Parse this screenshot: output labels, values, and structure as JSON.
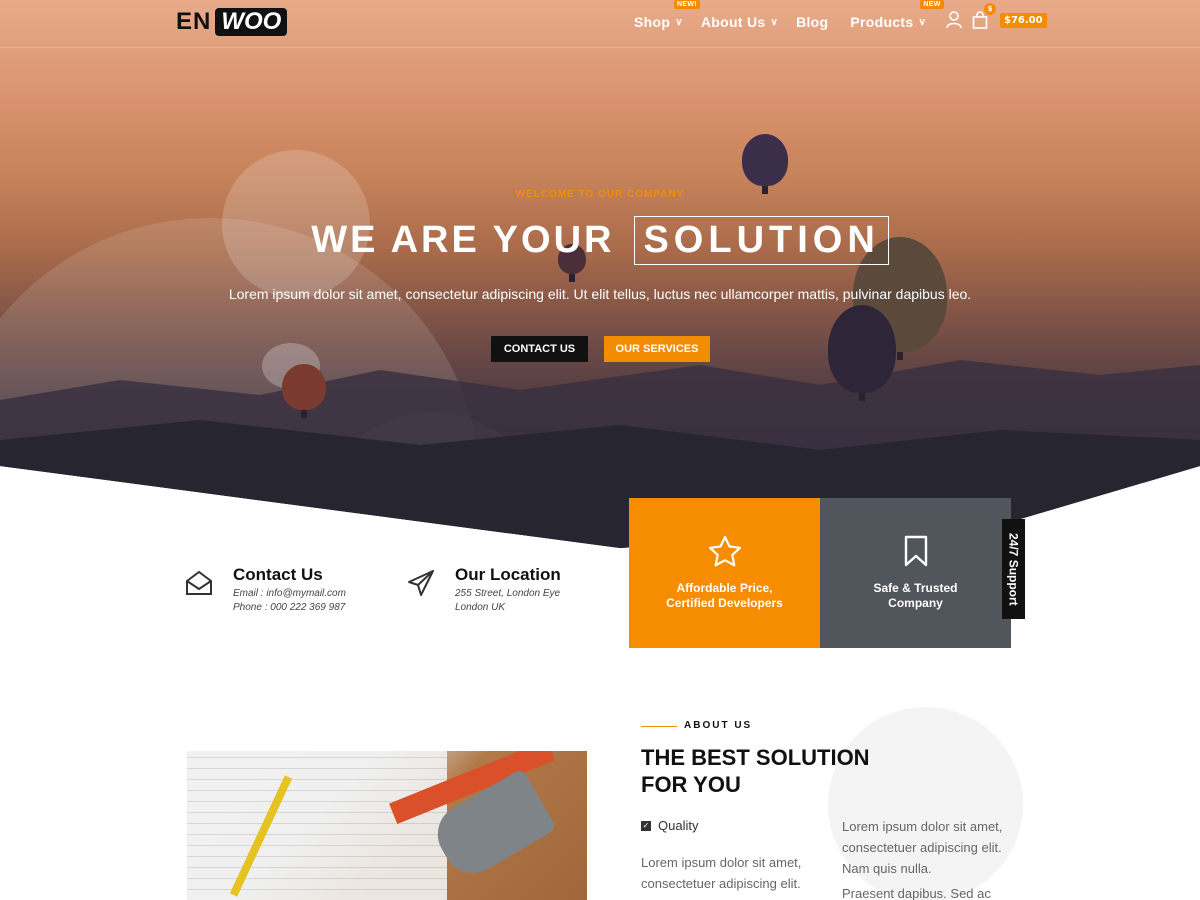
{
  "header": {
    "logo_left": "EN",
    "logo_right": "WOO",
    "nav": [
      {
        "label": "Shop",
        "tag": "NEW!"
      },
      {
        "label": "About Us",
        "tag": ""
      },
      {
        "label": "Blog",
        "tag": ""
      },
      {
        "label": "Products",
        "tag": "NEW"
      }
    ],
    "cart_count": "$",
    "cart_price": "$76.00"
  },
  "hero": {
    "eyebrow": "WELCOME TO OUR COMPANY",
    "headline_plain": "WE ARE YOUR",
    "headline_boxed": "SOLUTION",
    "subtitle": "Lorem ipsum dolor sit amet, consectetur adipiscing elit. Ut elit tellus, luctus nec ullamcorper mattis, pulvinar dapibus leo.",
    "btn_contact": "CONTACT US",
    "btn_services": "OUR SERVICES"
  },
  "info": {
    "contact": {
      "title": "Contact Us",
      "line1": "Email : info@mymail.com",
      "line2": "Phone : 000 222 369 987"
    },
    "location": {
      "title": "Our Location",
      "line1": "255 Street, London Eye",
      "line2": "London UK"
    }
  },
  "features": [
    {
      "line1": "Affordable Price,",
      "line2": "Certified Developers",
      "icon": "star-icon"
    },
    {
      "line1": "Safe & Trusted",
      "line2": "Company",
      "icon": "bookmark-icon"
    }
  ],
  "support_tab": "24/7 Support",
  "about": {
    "label": "ABOUT US",
    "title_a": "THE BEST ",
    "title_b": "SOLUTION",
    "title_c": "FOR YOU",
    "quality": "Quality",
    "para_left_1": "Lorem ipsum dolor sit amet,",
    "para_left_2": "consectetuer adipiscing elit.",
    "para_right_1": "Lorem ipsum dolor sit amet,",
    "para_right_2": "consectetuer adipiscing elit.",
    "para_right_3": "Nam quis nulla.",
    "para_right_4": "Praesent dapibus. Sed ac"
  },
  "colors": {
    "accent": "#f28c00",
    "dark": "#111111",
    "gray_panel": "#51565c"
  }
}
